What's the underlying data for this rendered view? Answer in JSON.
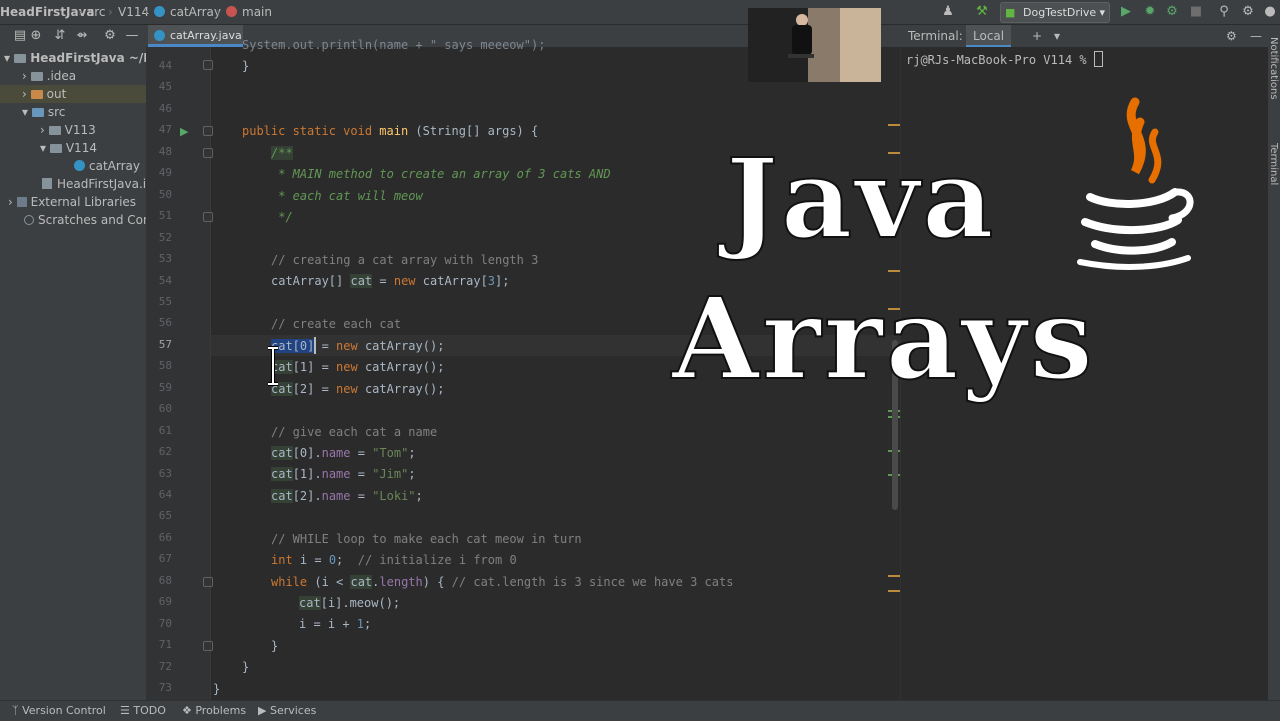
{
  "breadcrumb": {
    "project": "HeadFirstJava",
    "src": "src",
    "pkg": "V114",
    "cls": "catArray",
    "method": "main"
  },
  "toolbar": {
    "run_config": "DogTestDrive"
  },
  "editor_tab": {
    "label": "catArray.java"
  },
  "project_tree": [
    {
      "label": "HeadFirstJava ~/D",
      "kind": "root"
    },
    {
      "label": ".idea",
      "kind": "folder"
    },
    {
      "label": "out",
      "kind": "folder-orange"
    },
    {
      "label": "src",
      "kind": "folder-blue"
    },
    {
      "label": "V113",
      "kind": "package"
    },
    {
      "label": "V114",
      "kind": "package"
    },
    {
      "label": "catArray",
      "kind": "class"
    },
    {
      "label": "HeadFirstJava.ir",
      "kind": "file"
    },
    {
      "label": "External Libraries",
      "kind": "lib"
    },
    {
      "label": "Scratches and Con",
      "kind": "scratch"
    }
  ],
  "line_numbers": [
    "44",
    "45",
    "46",
    "47",
    "48",
    "49",
    "50",
    "51",
    "52",
    "53",
    "54",
    "55",
    "56",
    "57",
    "58",
    "59",
    "60",
    "61",
    "62",
    "63",
    "64",
    "65",
    "66",
    "67",
    "68",
    "69",
    "70",
    "71",
    "72",
    "73"
  ],
  "code": {
    "partial_top": "System.out.println(name + \" says meeeow\");",
    "l44": "}",
    "l47_a": "public static void ",
    "l47_b": "main",
    "l47_c": " (String[] args) {",
    "l48": "/**",
    "l49": " * MAIN method to create an array of 3 cats AND",
    "l50": " * each cat will meow",
    "l51": " */",
    "l53": "// creating a cat array with length 3",
    "l54_a": "catArray[] ",
    "l54_b": "cat",
    "l54_c": " = ",
    "l54_d": "new",
    "l54_e": " catArray[",
    "l54_f": "3",
    "l54_g": "];",
    "l56": "// create each cat",
    "l57_a": "cat[0]",
    "l57_b": " = ",
    "l57_c": "new",
    "l57_d": " catArray();",
    "l58_a": "cat",
    "l58_b": "[1] = ",
    "l58_c": "new",
    "l58_d": " catArray();",
    "l59_a": "cat",
    "l59_b": "[2] = ",
    "l59_c": "new",
    "l59_d": " catArray();",
    "l61": "// give each cat a name",
    "l62_a": "cat",
    "l62_b": "[0].",
    "l62_c": "name",
    "l62_d": " = ",
    "l62_e": "\"Tom\"",
    "l62_f": ";",
    "l63_e": "\"Jim\"",
    "l63_b": "[1].",
    "l64_e": "\"Loki\"",
    "l64_b": "[2].",
    "l66": "// WHILE loop to make each cat meow in turn",
    "l67_a": "int",
    "l67_b": " i = ",
    "l67_c": "0",
    "l67_d": ";  ",
    "l67_e": "// initialize i from 0",
    "l68_a": "while",
    "l68_b": " (i < ",
    "l68_c": "cat",
    "l68_d": ".",
    "l68_e": "length",
    "l68_f": ") { ",
    "l68_g": "// cat.length is 3 since we have 3 cats",
    "l69_a": "cat",
    "l69_b": "[i].meow();",
    "l70_a": "i = i + ",
    "l70_b": "1",
    "l70_c": ";",
    "close": "}"
  },
  "terminal": {
    "label": "Terminal:",
    "tab": "Local",
    "prompt": "rj@RJs-MacBook-Pro V114 % "
  },
  "side_labels": {
    "notifications": "Notifications",
    "terminal": "Terminal"
  },
  "bottom_tools": [
    "Version Control",
    "TODO",
    "Problems",
    "Services"
  ],
  "overlay": {
    "line1": "Java",
    "line2": "Arrays"
  },
  "colors": {
    "keyword": "#cc7832",
    "method": "#ffc66d",
    "comment": "#808080",
    "doc": "#629755",
    "string": "#6a8759",
    "number": "#6897bb",
    "field": "#9876aa",
    "selection": "#214283"
  }
}
